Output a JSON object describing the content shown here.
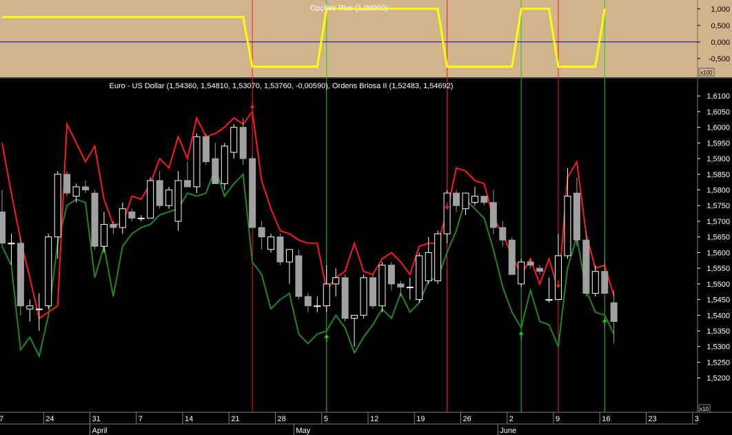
{
  "colors": {
    "top_bg": "#cfb48c",
    "main_bg": "#000000",
    "osc_line": "#ffff00",
    "zero_line": "#0000c8",
    "upper_band": "#ff1a1a",
    "lower_band": "#1f8a1f",
    "sell_marker": "#ff1a1a",
    "buy_marker": "#22cc22",
    "bull_candle": "#ffffff",
    "bear_candle": "#a0a0a0"
  },
  "chart_data": [
    {
      "type": "line",
      "title": "Opções Plus (1,00000)",
      "axis_scale_label": "x100",
      "y_ticks": [
        "1,000",
        "0,500",
        "0,000",
        "-0,500"
      ],
      "y_tick_values": [
        1,
        0.5,
        0,
        -0.5
      ],
      "ylim": [
        -0.9,
        1.1
      ],
      "reference_line": 0,
      "series": [
        {
          "values": [
            0.75,
            0.75,
            0.75,
            0.75,
            0.75,
            0.75,
            0.75,
            0.75,
            0.75,
            0.75,
            0.75,
            0.75,
            0.75,
            0.75,
            0.75,
            0.75,
            0.75,
            0.75,
            0.75,
            0.75,
            0.75,
            0.75,
            0.75,
            0.75,
            0.75,
            0.75,
            0.75,
            -0.75,
            -0.75,
            -0.75,
            -0.75,
            -0.75,
            -0.75,
            -0.75,
            -0.75,
            1,
            1,
            1,
            1,
            1,
            1,
            1,
            1,
            1,
            1,
            1,
            1,
            1,
            -0.75,
            -0.75,
            -0.75,
            -0.75,
            -0.75,
            -0.75,
            -0.75,
            -0.75,
            1,
            1,
            1,
            1,
            -0.75,
            -0.75,
            -0.75,
            -0.75,
            -0.75,
            1
          ]
        }
      ],
      "signal_sessions": {
        "sell": [
          27,
          48,
          60
        ],
        "buy": [
          35,
          56,
          65
        ]
      }
    },
    {
      "type": "candlestick",
      "title": "Euro - US Dollar (1,54360, 1,54810, 1,53070, 1,53760, -0,00590), Ordens Briosa II (1,52483, 1,54692)",
      "axis_scale_label": "x10",
      "ylim": [
        1.513,
        1.614
      ],
      "y_ticks": [
        "1,6100",
        "1,6050",
        "1,6000",
        "1,5950",
        "1,5900",
        "1,5850",
        "1,5800",
        "1,5750",
        "1,5700",
        "1,5650",
        "1,5600",
        "1,5550",
        "1,5500",
        "1,5450",
        "1,5400",
        "1,5350",
        "1,5300",
        "1,5250",
        "1,5200"
      ],
      "y_tick_values": [
        1.61,
        1.605,
        1.6,
        1.595,
        1.59,
        1.585,
        1.58,
        1.575,
        1.57,
        1.565,
        1.56,
        1.555,
        1.55,
        1.545,
        1.54,
        1.535,
        1.53,
        1.525,
        1.52
      ],
      "x_day_ticks": [
        {
          "label": "7",
          "session": 0
        },
        {
          "label": "24",
          "session": 5
        },
        {
          "label": "31",
          "session": 10
        },
        {
          "label": "7",
          "session": 15
        },
        {
          "label": "14",
          "session": 20
        },
        {
          "label": "21",
          "session": 25
        },
        {
          "label": "28",
          "session": 30
        },
        {
          "label": "5",
          "session": 35
        },
        {
          "label": "12",
          "session": 40
        },
        {
          "label": "19",
          "session": 45
        },
        {
          "label": "26",
          "session": 50
        },
        {
          "label": "2",
          "session": 55
        },
        {
          "label": "9",
          "session": 60
        },
        {
          "label": "16",
          "session": 65
        },
        {
          "label": "23",
          "session": 70
        },
        {
          "label": "3",
          "session": 75
        }
      ],
      "x_month_labels": [
        {
          "label": "April",
          "session": 10
        },
        {
          "label": "May",
          "session": 32
        },
        {
          "label": "June",
          "session": 54
        }
      ],
      "candles": [
        {
          "o": 1.573,
          "h": 1.58,
          "l": 1.562,
          "c": 1.563
        },
        {
          "o": 1.563,
          "h": 1.566,
          "l": 1.556,
          "c": 1.563
        },
        {
          "o": 1.563,
          "h": 1.565,
          "l": 1.54,
          "c": 1.543
        },
        {
          "o": 1.542,
          "h": 1.545,
          "l": 1.538,
          "c": 1.543
        },
        {
          "o": 1.542,
          "h": 1.547,
          "l": 1.535,
          "c": 1.542
        },
        {
          "o": 1.543,
          "h": 1.566,
          "l": 1.542,
          "c": 1.565
        },
        {
          "o": 1.565,
          "h": 1.586,
          "l": 1.558,
          "c": 1.585
        },
        {
          "o": 1.585,
          "h": 1.586,
          "l": 1.578,
          "c": 1.579
        },
        {
          "o": 1.578,
          "h": 1.582,
          "l": 1.576,
          "c": 1.581
        },
        {
          "o": 1.581,
          "h": 1.583,
          "l": 1.579,
          "c": 1.58
        },
        {
          "o": 1.579,
          "h": 1.58,
          "l": 1.561,
          "c": 1.562
        },
        {
          "o": 1.562,
          "h": 1.573,
          "l": 1.56,
          "c": 1.569
        },
        {
          "o": 1.569,
          "h": 1.57,
          "l": 1.566,
          "c": 1.568
        },
        {
          "o": 1.568,
          "h": 1.576,
          "l": 1.566,
          "c": 1.574
        },
        {
          "o": 1.573,
          "h": 1.574,
          "l": 1.57,
          "c": 1.571
        },
        {
          "o": 1.571,
          "h": 1.572,
          "l": 1.57,
          "c": 1.571
        },
        {
          "o": 1.571,
          "h": 1.584,
          "l": 1.571,
          "c": 1.583
        },
        {
          "o": 1.583,
          "h": 1.586,
          "l": 1.574,
          "c": 1.575
        },
        {
          "o": 1.575,
          "h": 1.581,
          "l": 1.574,
          "c": 1.58
        },
        {
          "o": 1.57,
          "h": 1.586,
          "l": 1.567,
          "c": 1.583
        },
        {
          "o": 1.583,
          "h": 1.589,
          "l": 1.581,
          "c": 1.581
        },
        {
          "o": 1.581,
          "h": 1.598,
          "l": 1.579,
          "c": 1.597
        },
        {
          "o": 1.597,
          "h": 1.598,
          "l": 1.588,
          "c": 1.589
        },
        {
          "o": 1.59,
          "h": 1.595,
          "l": 1.582,
          "c": 1.582
        },
        {
          "o": 1.582,
          "h": 1.595,
          "l": 1.58,
          "c": 1.594
        },
        {
          "o": 1.592,
          "h": 1.601,
          "l": 1.59,
          "c": 1.6
        },
        {
          "o": 1.6,
          "h": 1.603,
          "l": 1.588,
          "c": 1.59
        },
        {
          "o": 1.59,
          "h": 1.591,
          "l": 1.568,
          "c": 1.568
        },
        {
          "o": 1.568,
          "h": 1.57,
          "l": 1.561,
          "c": 1.565
        },
        {
          "o": 1.561,
          "h": 1.566,
          "l": 1.56,
          "c": 1.565
        },
        {
          "o": 1.565,
          "h": 1.566,
          "l": 1.556,
          "c": 1.557
        },
        {
          "o": 1.557,
          "h": 1.561,
          "l": 1.55,
          "c": 1.561
        },
        {
          "o": 1.559,
          "h": 1.561,
          "l": 1.545,
          "c": 1.546
        },
        {
          "o": 1.546,
          "h": 1.547,
          "l": 1.541,
          "c": 1.543
        },
        {
          "o": 1.543,
          "h": 1.546,
          "l": 1.541,
          "c": 1.543
        },
        {
          "o": 1.543,
          "h": 1.556,
          "l": 1.541,
          "c": 1.55
        },
        {
          "o": 1.55,
          "h": 1.555,
          "l": 1.546,
          "c": 1.552
        },
        {
          "o": 1.552,
          "h": 1.553,
          "l": 1.538,
          "c": 1.539
        },
        {
          "o": 1.539,
          "h": 1.54,
          "l": 1.53,
          "c": 1.54
        },
        {
          "o": 1.54,
          "h": 1.553,
          "l": 1.539,
          "c": 1.552
        },
        {
          "o": 1.552,
          "h": 1.553,
          "l": 1.542,
          "c": 1.543
        },
        {
          "o": 1.543,
          "h": 1.557,
          "l": 1.541,
          "c": 1.556
        },
        {
          "o": 1.556,
          "h": 1.557,
          "l": 1.548,
          "c": 1.55
        },
        {
          "o": 1.55,
          "h": 1.551,
          "l": 1.546,
          "c": 1.549
        },
        {
          "o": 1.549,
          "h": 1.552,
          "l": 1.545,
          "c": 1.549
        },
        {
          "o": 1.545,
          "h": 1.56,
          "l": 1.544,
          "c": 1.559
        },
        {
          "o": 1.551,
          "h": 1.565,
          "l": 1.55,
          "c": 1.56
        },
        {
          "o": 1.551,
          "h": 1.567,
          "l": 1.55,
          "c": 1.566
        },
        {
          "o": 1.566,
          "h": 1.58,
          "l": 1.563,
          "c": 1.579
        },
        {
          "o": 1.579,
          "h": 1.58,
          "l": 1.573,
          "c": 1.575
        },
        {
          "o": 1.574,
          "h": 1.579,
          "l": 1.572,
          "c": 1.579
        },
        {
          "o": 1.576,
          "h": 1.581,
          "l": 1.575,
          "c": 1.578
        },
        {
          "o": 1.578,
          "h": 1.578,
          "l": 1.575,
          "c": 1.576
        },
        {
          "o": 1.576,
          "h": 1.58,
          "l": 1.566,
          "c": 1.568
        },
        {
          "o": 1.568,
          "h": 1.57,
          "l": 1.562,
          "c": 1.564
        },
        {
          "o": 1.564,
          "h": 1.565,
          "l": 1.553,
          "c": 1.553
        },
        {
          "o": 1.55,
          "h": 1.558,
          "l": 1.549,
          "c": 1.557
        },
        {
          "o": 1.557,
          "h": 1.558,
          "l": 1.555,
          "c": 1.556
        },
        {
          "o": 1.555,
          "h": 1.556,
          "l": 1.553,
          "c": 1.554
        },
        {
          "o": 1.545,
          "h": 1.552,
          "l": 1.544,
          "c": 1.545
        },
        {
          "o": 1.545,
          "h": 1.566,
          "l": 1.545,
          "c": 1.559
        },
        {
          "o": 1.559,
          "h": 1.587,
          "l": 1.558,
          "c": 1.578
        },
        {
          "o": 1.579,
          "h": 1.584,
          "l": 1.562,
          "c": 1.564
        },
        {
          "o": 1.564,
          "h": 1.567,
          "l": 1.546,
          "c": 1.547
        },
        {
          "o": 1.547,
          "h": 1.556,
          "l": 1.546,
          "c": 1.554
        },
        {
          "o": 1.554,
          "h": 1.558,
          "l": 1.547,
          "c": 1.547
        },
        {
          "o": 1.544,
          "h": 1.548,
          "l": 1.531,
          "c": 1.538
        }
      ],
      "series": [
        {
          "name": "Ordens Briosa II upper",
          "values": [
            1.595,
            1.579,
            1.564,
            1.552,
            1.539,
            1.541,
            1.543,
            1.601,
            1.595,
            1.589,
            1.594,
            1.577,
            1.569,
            1.569,
            1.578,
            1.577,
            1.582,
            1.59,
            1.587,
            1.597,
            1.59,
            1.603,
            1.597,
            1.598,
            1.6,
            1.603,
            1.601,
            1.605,
            1.583,
            1.574,
            1.567,
            1.566,
            1.564,
            1.563,
            1.563,
            1.548,
            1.552,
            1.554,
            1.563,
            1.554,
            1.553,
            1.558,
            1.56,
            1.557,
            1.553,
            1.562,
            1.563,
            1.563,
            1.573,
            1.587,
            1.586,
            1.583,
            1.582,
            1.571,
            1.566,
            1.559,
            1.553,
            1.558,
            1.55,
            1.558,
            1.548,
            1.584,
            1.589,
            1.566,
            1.555,
            1.556,
            1.546
          ]
        },
        {
          "name": "Ordens Briosa II lower",
          "values": [
            1.562,
            1.556,
            1.529,
            1.533,
            1.527,
            1.54,
            1.563,
            1.575,
            1.577,
            1.576,
            1.552,
            1.562,
            1.546,
            1.562,
            1.566,
            1.568,
            1.569,
            1.572,
            1.573,
            1.574,
            1.579,
            1.578,
            1.579,
            1.587,
            1.578,
            1.582,
            1.585,
            1.557,
            1.553,
            1.542,
            1.545,
            1.547,
            1.534,
            1.531,
            1.534,
            1.535,
            1.54,
            1.536,
            1.528,
            1.533,
            1.537,
            1.542,
            1.539,
            1.547,
            1.541,
            1.544,
            1.551,
            1.552,
            1.56,
            1.567,
            1.577,
            1.574,
            1.571,
            1.561,
            1.549,
            1.541,
            1.536,
            1.548,
            1.538,
            1.537,
            1.53,
            1.555,
            1.565,
            1.548,
            1.541,
            1.54,
            1.534
          ]
        }
      ],
      "signal_sessions": {
        "sell": [
          27,
          48,
          60
        ],
        "buy": [
          35,
          56,
          65
        ]
      }
    }
  ]
}
